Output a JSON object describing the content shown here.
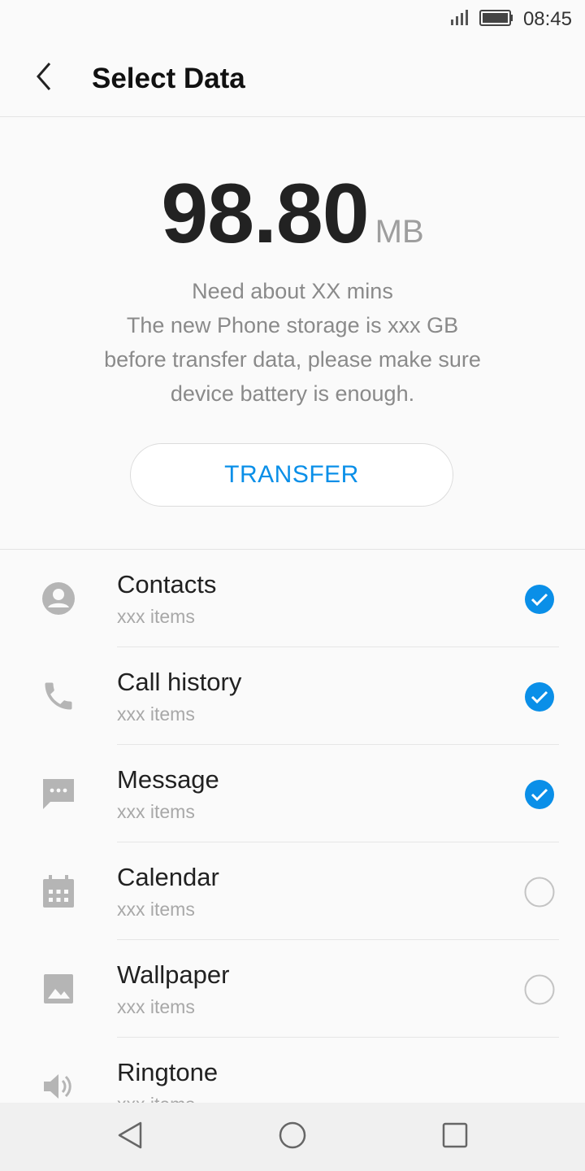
{
  "status_bar": {
    "time": "08:45"
  },
  "header": {
    "title": "Select Data"
  },
  "summary": {
    "size_value": "98.80",
    "size_unit": "MB",
    "lines": [
      "Need about XX mins",
      "The new Phone storage is xxx GB",
      "before transfer data, please make sure",
      "device battery is enough."
    ],
    "transfer_label": "TRANSFER"
  },
  "items": [
    {
      "label": "Contacts",
      "sub": "xxx items",
      "icon": "contacts-icon",
      "checked": true
    },
    {
      "label": "Call history",
      "sub": "xxx items",
      "icon": "phone-icon",
      "checked": true
    },
    {
      "label": "Message",
      "sub": "xxx items",
      "icon": "message-icon",
      "checked": true
    },
    {
      "label": "Calendar",
      "sub": "xxx items",
      "icon": "calendar-icon",
      "checked": false
    },
    {
      "label": "Wallpaper",
      "sub": "xxx items",
      "icon": "image-icon",
      "checked": false
    },
    {
      "label": "Ringtone",
      "sub": "xxx items",
      "icon": "speaker-icon",
      "checked": null
    }
  ],
  "colors": {
    "accent": "#0a8fe8",
    "icon_gray": "#b5b5b5"
  }
}
